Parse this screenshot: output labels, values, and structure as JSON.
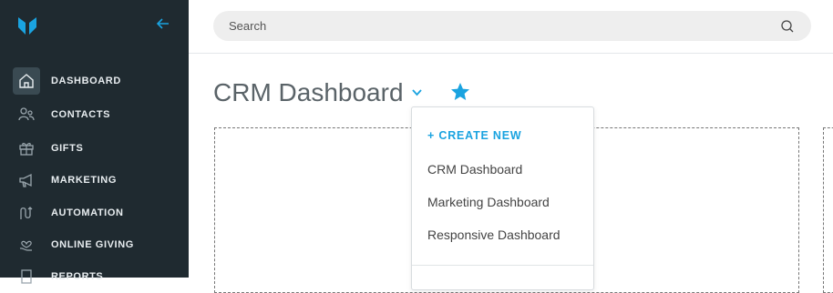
{
  "sidebar": {
    "items": [
      {
        "label": "DASHBOARD",
        "icon": "home-icon"
      },
      {
        "label": "CONTACTS",
        "icon": "contacts-icon"
      },
      {
        "label": "GIFTS",
        "icon": "gift-icon"
      },
      {
        "label": "MARKETING",
        "icon": "megaphone-icon"
      },
      {
        "label": "AUTOMATION",
        "icon": "automation-icon"
      },
      {
        "label": "ONLINE GIVING",
        "icon": "heart-hand-icon"
      },
      {
        "label": "REPORTS",
        "icon": "report-icon"
      }
    ]
  },
  "search": {
    "placeholder": "Search"
  },
  "page": {
    "title": "CRM Dashboard"
  },
  "menu": {
    "create": "+ CREATE NEW",
    "items": [
      "CRM Dashboard",
      "Marketing Dashboard",
      "Responsive Dashboard"
    ]
  },
  "colors": {
    "accent": "#1aa3e0",
    "sidebar": "#1f2a30"
  }
}
